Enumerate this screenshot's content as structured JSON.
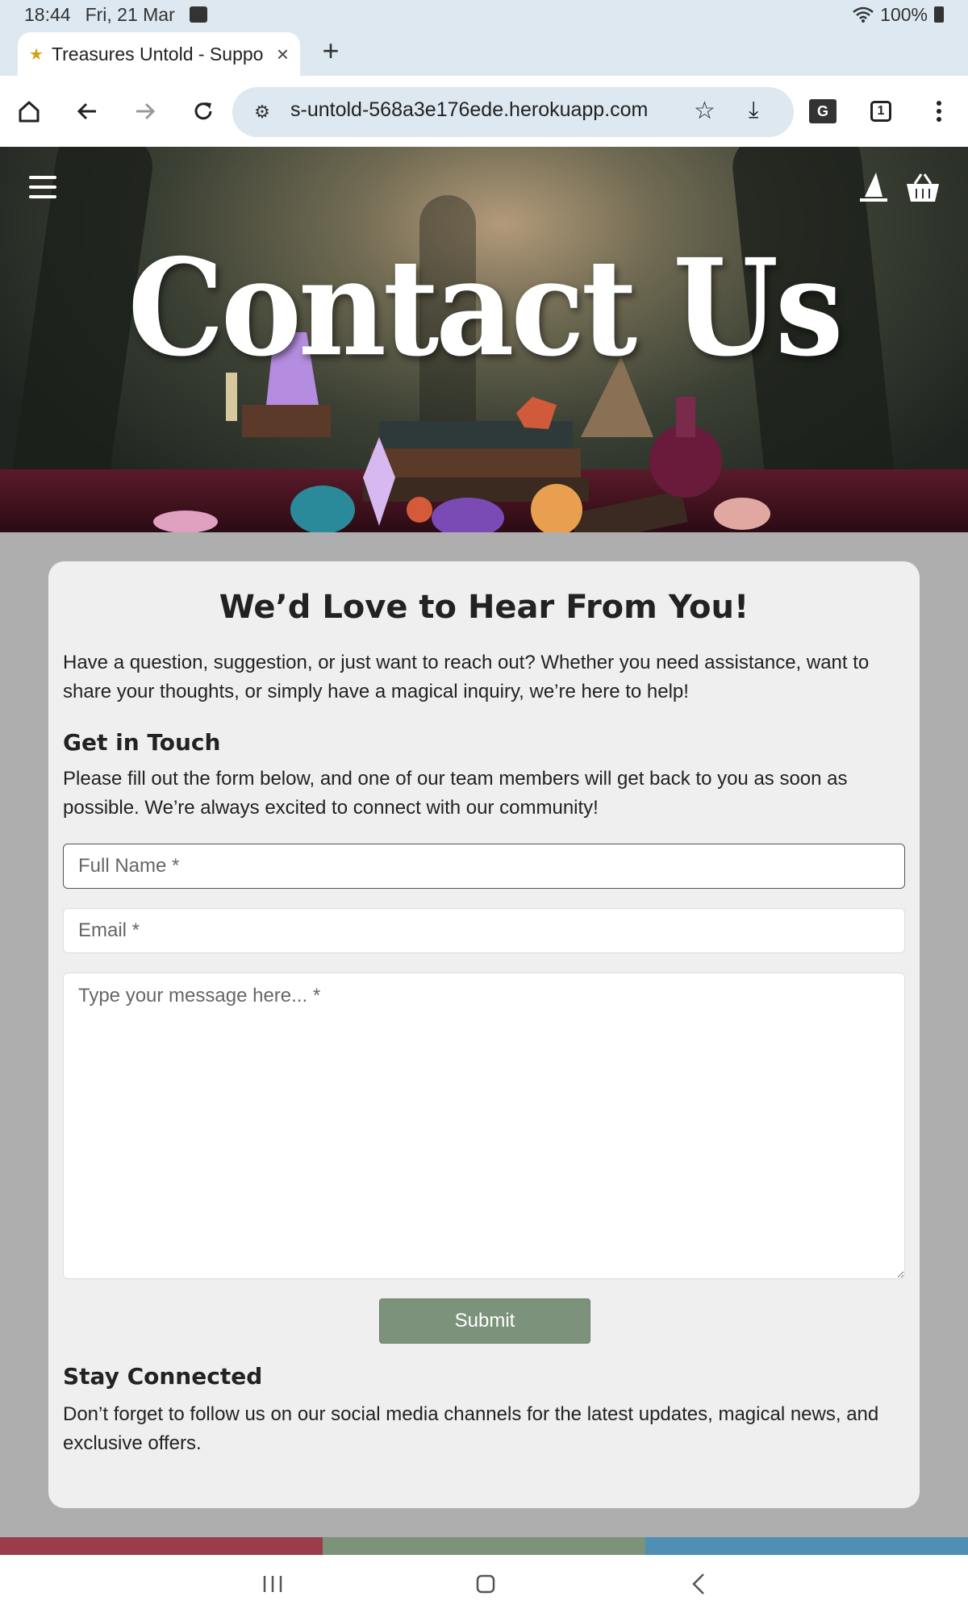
{
  "status_bar": {
    "time": "18:44",
    "date": "Fri, 21 Mar",
    "battery": "100%"
  },
  "tab": {
    "title": "Treasures Untold - Suppo",
    "close_icon": "close-icon"
  },
  "toolbar": {
    "url": "s-untold-568a3e176ede.herokuapp.com",
    "tabs_count": "1",
    "translate_label": "G"
  },
  "hero": {
    "title": "Contact Us"
  },
  "content": {
    "heading": "We’d Love to Hear From You!",
    "intro": "Have a question, suggestion, or just want to reach out? Whether you need assistance, want to share your thoughts, or simply have a magical inquiry, we’re here to help!",
    "touch_heading": "Get in Touch",
    "touch_text": "Please fill out the form below, and one of our team members will get back to you as soon as possible. We’re always excited to connect with our community!",
    "form": {
      "name_placeholder": "Full Name *",
      "email_placeholder": "Email *",
      "message_placeholder": "Type your message here... *",
      "submit_label": "Submit"
    },
    "stay_heading": "Stay Connected",
    "stay_text": "Don’t forget to follow us on our social media channels for the latest updates, magical news, and exclusive offers."
  },
  "colors": {
    "submit_bg": "#7d927b",
    "footer": [
      "#9a3c4a",
      "#7d927b",
      "#4f8fb3"
    ]
  }
}
